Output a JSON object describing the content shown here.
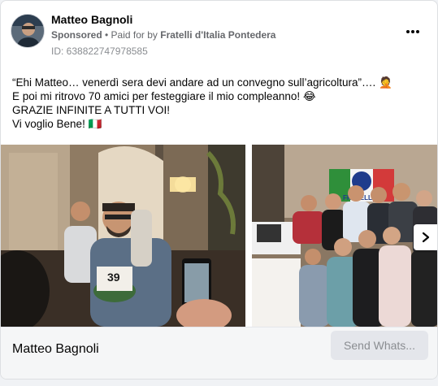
{
  "post": {
    "author": "Matteo Bagnoli",
    "sponsored_label": "Sponsored",
    "paid_for_prefix": " • Paid for by ",
    "payer": "Fratelli d'Italia Pontedera",
    "ad_id": "ID: 638822747978585",
    "text_lines": [
      "“Ehi Matteo… venerdì sera devi andare ad un convegno sull’agricoltura”….  🤦",
      "E poi mi ritrovo 70 amici per festeggiare il mio compleanno! 😂",
      "GRAZIE INFINITE A TUTTI VOI!",
      "Vi voglio Bene! 🇮🇹"
    ]
  },
  "photos": {
    "left_alt": "Birthday celebration photo",
    "right_alt": "Group photo with Fratelli d'Italia banner",
    "banner_text": "FRATELLI",
    "cake_number": "39"
  },
  "footer": {
    "title": "Matteo Bagnoli",
    "cta_label": "Send Whats..."
  },
  "icons": {
    "more": "more-options-icon",
    "next": "chevron-right-icon"
  },
  "colors": {
    "card_bg": "#ffffff",
    "muted_text": "#65676b",
    "cta_bg": "#e4e6eb"
  }
}
